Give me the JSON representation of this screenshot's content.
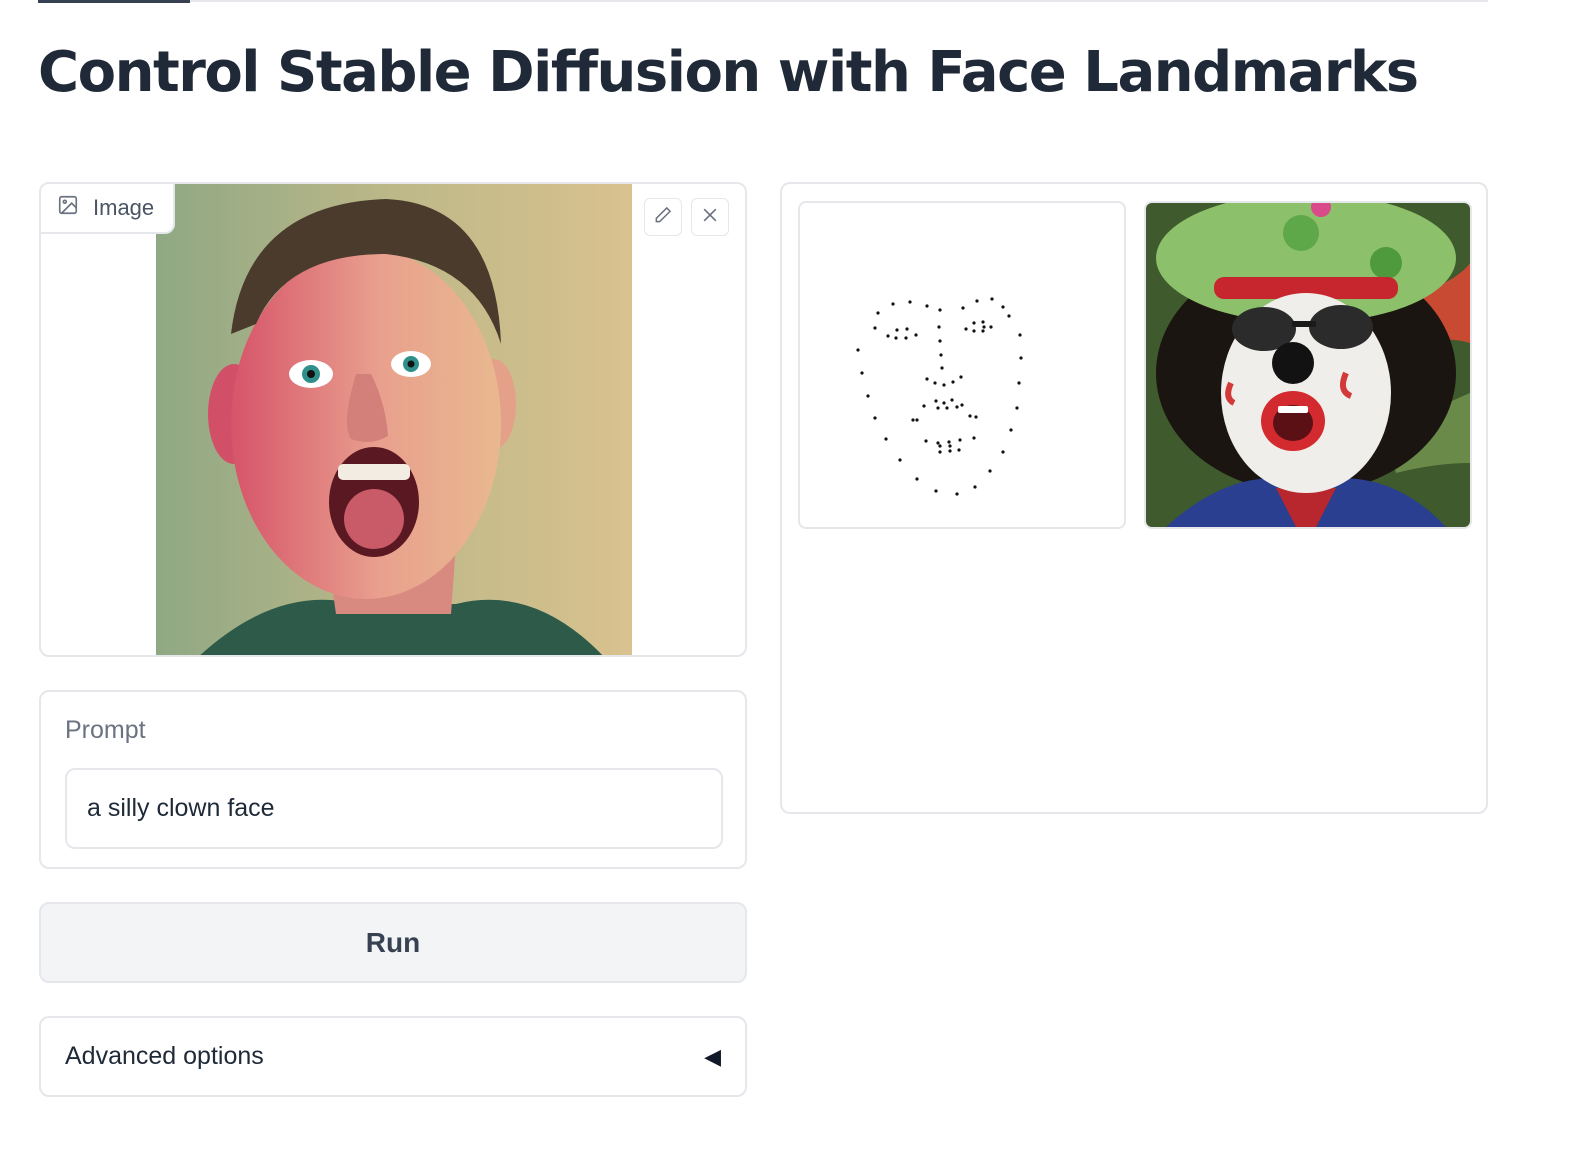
{
  "page": {
    "title": "Control Stable Diffusion with Face Landmarks"
  },
  "input_image": {
    "label": "Image",
    "label_icon": "image-icon",
    "edit_icon": "pencil-icon",
    "clear_icon": "close-icon"
  },
  "prompt": {
    "label": "Prompt",
    "value": "a silly clown face"
  },
  "run_button": {
    "label": "Run"
  },
  "advanced_options": {
    "label": "Advanced options",
    "icon": "triangle-left-icon"
  },
  "gallery": {
    "items": [
      {
        "kind": "face-landmarks-map"
      },
      {
        "kind": "generated-clown-face"
      }
    ]
  }
}
